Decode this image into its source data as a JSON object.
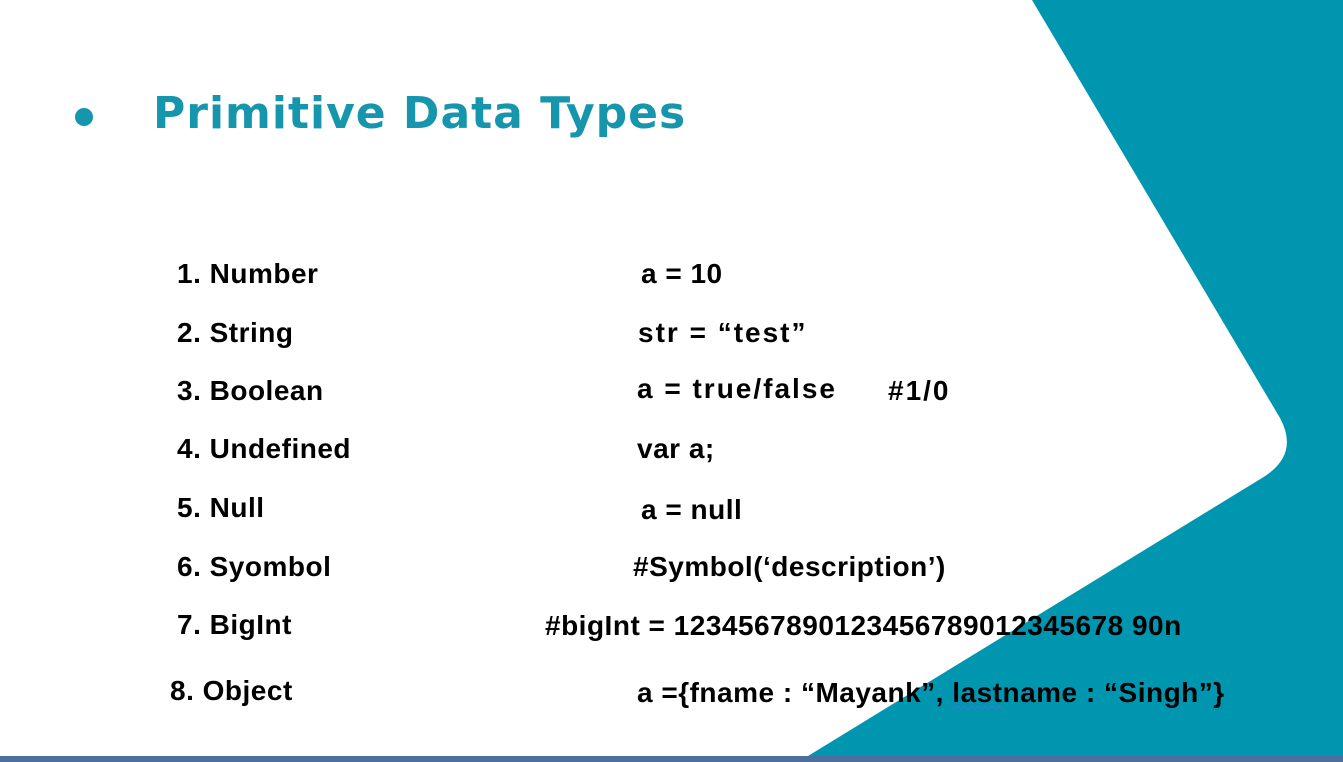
{
  "slide": {
    "title": "Primitive Data Types",
    "colors": {
      "accent": "#1596ad",
      "teal_panel": "#0096b0",
      "bottom_bar": "#4e6e9c"
    },
    "items": [
      {
        "label": "1. Number",
        "example": "a = 10"
      },
      {
        "label": "2. String",
        "example": "str = “test”"
      },
      {
        "label": "3. Boolean",
        "example": "a = true/false",
        "note": "#1/0"
      },
      {
        "label": "4. Undefined",
        "example": "var a;"
      },
      {
        "label": "5.  Null",
        "example": "a = null"
      },
      {
        "label": "6. Syombol",
        "example": "#Symbol(‘description’)"
      },
      {
        "label": "7.  BigInt",
        "example": "#bigInt = 1234567890123456789012345678 90n"
      },
      {
        "label": "8. Object",
        "example_prefix": "a ={fname : “Mayank”, ",
        "example_squiggle": "last",
        "example_suffix": "name : “Singh”}"
      }
    ]
  }
}
